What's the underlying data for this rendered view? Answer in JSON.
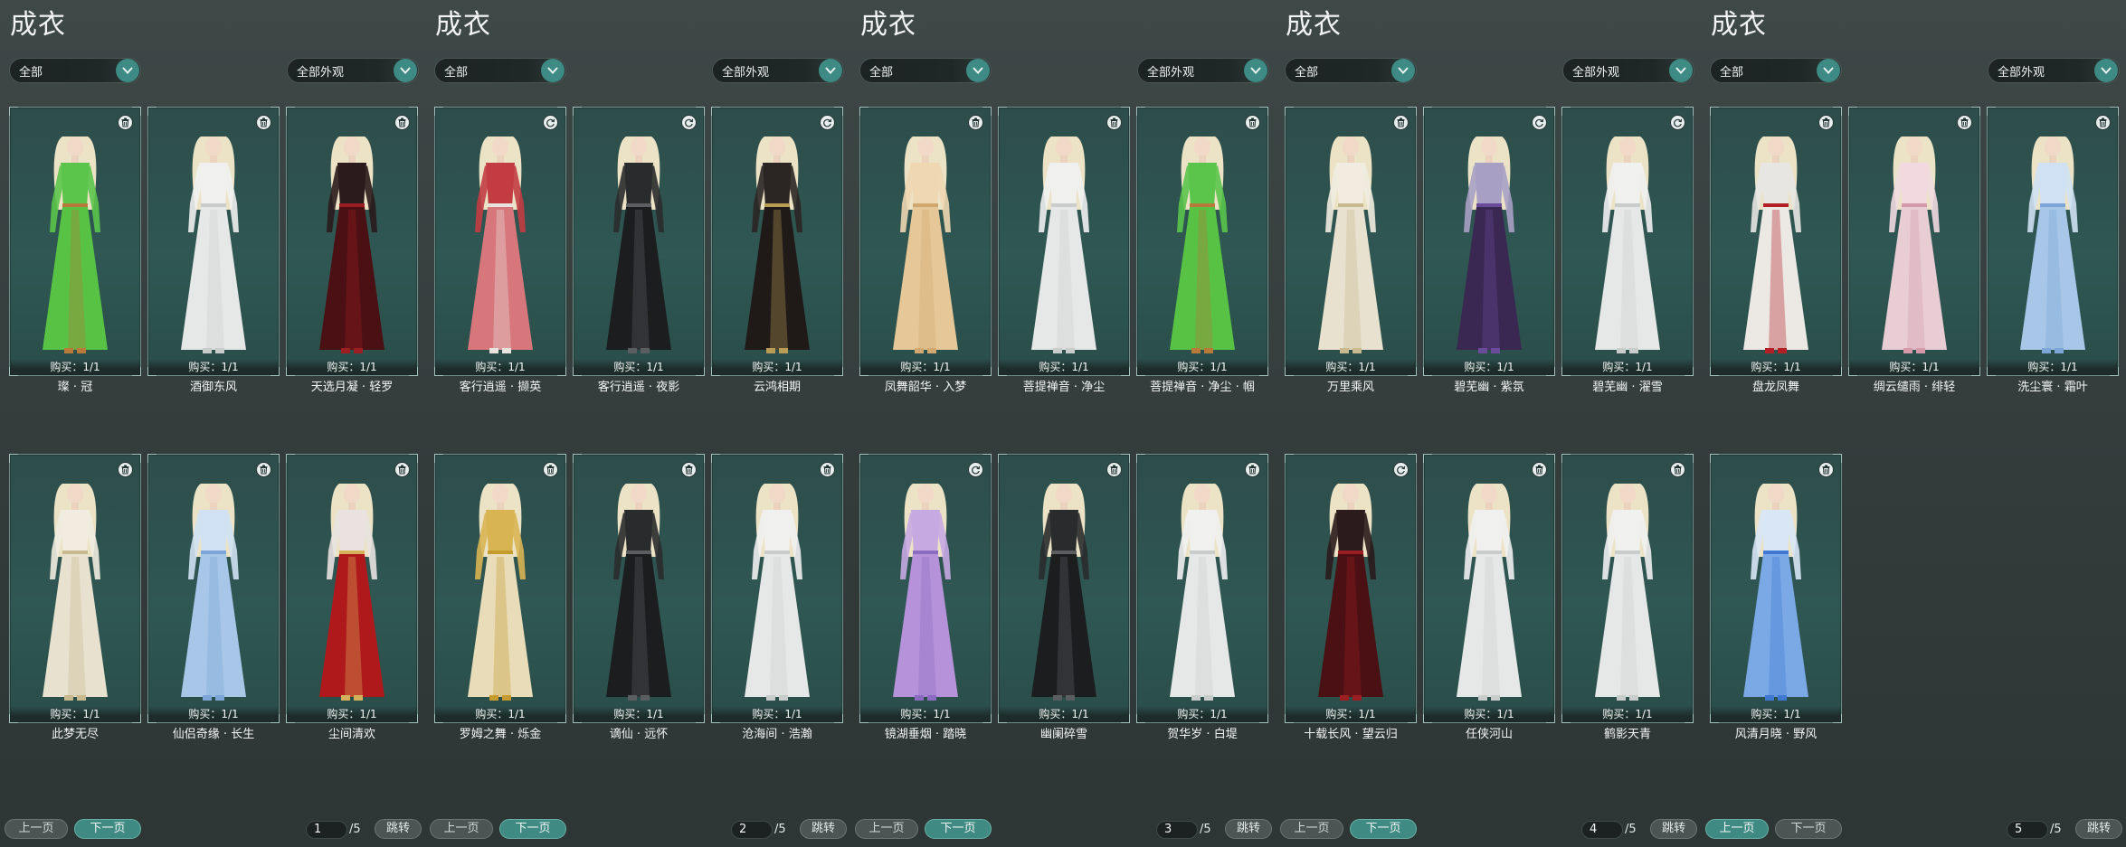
{
  "panels": [
    {
      "title": "成衣",
      "filter_category": "全部",
      "filter_appearance": "全部外观",
      "items": [
        {
          "name": "璨 · 冠",
          "buy": "购买：1/1",
          "icon": "trash-icon",
          "palette": "green"
        },
        {
          "name": "酒御东风",
          "buy": "购买：1/1",
          "icon": "trash-icon",
          "palette": "white"
        },
        {
          "name": "天选月凝 · 轻罗",
          "buy": "购买：1/1",
          "icon": "trash-icon",
          "palette": "blackred"
        },
        {
          "name": "此梦无尽",
          "buy": "购买：1/1",
          "icon": "trash-icon",
          "palette": "cream"
        },
        {
          "name": "仙侣奇缘 · 长生",
          "buy": "购买：1/1",
          "icon": "trash-icon",
          "palette": "lightblue"
        },
        {
          "name": "尘间清欢",
          "buy": "购买：1/1",
          "icon": "trash-icon",
          "palette": "red"
        }
      ],
      "pagination": {
        "prev": "上一页",
        "next": "下一页",
        "page": "1",
        "total": "/5",
        "jump": "跳转",
        "active": "next"
      }
    },
    {
      "title": "成衣",
      "filter_category": "全部",
      "filter_appearance": "全部外观",
      "items": [
        {
          "name": "客行逍遥 · 撷英",
          "buy": "购买：1/1",
          "icon": "refresh-icon",
          "palette": "pinkred"
        },
        {
          "name": "客行逍遥 · 夜影",
          "buy": "购买：1/1",
          "icon": "refresh-icon",
          "palette": "black"
        },
        {
          "name": "云鸿相期",
          "buy": "购买：1/1",
          "icon": "refresh-icon",
          "palette": "blackgold"
        },
        {
          "name": "罗姆之舞 · 烁金",
          "buy": "购买：1/1",
          "icon": "trash-icon",
          "palette": "gold"
        },
        {
          "name": "谪仙 · 远怀",
          "buy": "购买：1/1",
          "icon": "trash-icon",
          "palette": "black"
        },
        {
          "name": "沧海间 · 浩瀚",
          "buy": "购买：1/1",
          "icon": "trash-icon",
          "palette": "white"
        }
      ],
      "pagination": {
        "prev": "上一页",
        "next": "下一页",
        "page": "2",
        "total": "/5",
        "jump": "跳转",
        "active": "next"
      }
    },
    {
      "title": "成衣",
      "filter_category": "全部",
      "filter_appearance": "全部外观",
      "items": [
        {
          "name": "凤舞韶华 · 入梦",
          "buy": "购买：1/1",
          "icon": "trash-icon",
          "palette": "peach"
        },
        {
          "name": "菩提禅音 · 净尘",
          "buy": "购买：1/1",
          "icon": "trash-icon",
          "palette": "white"
        },
        {
          "name": "菩提禅音 · 净尘 · 帼",
          "buy": "购买：1/1",
          "icon": "trash-icon",
          "palette": "green"
        },
        {
          "name": "镜湖垂烟 · 踏晓",
          "buy": "购买：1/1",
          "icon": "refresh-icon",
          "palette": "lavender"
        },
        {
          "name": "幽阑碎雪",
          "buy": "购买：1/1",
          "icon": "trash-icon",
          "palette": "black"
        },
        {
          "name": "贺华岁 · 白堤",
          "buy": "购买：1/1",
          "icon": "trash-icon",
          "palette": "white"
        }
      ],
      "pagination": {
        "prev": "上一页",
        "next": "下一页",
        "page": "3",
        "total": "/5",
        "jump": "跳转",
        "active": "next"
      }
    },
    {
      "title": "成衣",
      "filter_category": "全部",
      "filter_appearance": "全部外观",
      "items": [
        {
          "name": "万里乘风",
          "buy": "购买：1/1",
          "icon": "trash-icon",
          "palette": "cream"
        },
        {
          "name": "碧芜幽 · 紫氛",
          "buy": "购买：1/1",
          "icon": "refresh-icon",
          "palette": "purple"
        },
        {
          "name": "碧芜幽 · 濯雪",
          "buy": "购买：1/1",
          "icon": "refresh-icon",
          "palette": "white"
        },
        {
          "name": "十载长风 · 望云归",
          "buy": "购买：1/1",
          "icon": "refresh-icon",
          "palette": "blackred"
        },
        {
          "name": "任侠河山",
          "buy": "购买：1/1",
          "icon": "trash-icon",
          "palette": "white"
        },
        {
          "name": "鹤影天青",
          "buy": "购买：1/1",
          "icon": "trash-icon",
          "palette": "white"
        }
      ],
      "pagination": {
        "prev": "上一页",
        "next": "下一页",
        "page": "4",
        "total": "/5",
        "jump": "跳转",
        "active": "next"
      }
    },
    {
      "title": "成衣",
      "filter_category": "全部",
      "filter_appearance": "全部外观",
      "items": [
        {
          "name": "盘龙凤舞",
          "buy": "购买：1/1",
          "icon": "trash-icon",
          "palette": "whitered"
        },
        {
          "name": "绸云缱雨 · 绯轻",
          "buy": "购买：1/1",
          "icon": "trash-icon",
          "palette": "pink"
        },
        {
          "name": "洗尘寰 · 霜叶",
          "buy": "购买：1/1",
          "icon": "trash-icon",
          "palette": "lightblue"
        },
        {
          "name": "风清月晓 · 野风",
          "buy": "购买：1/1",
          "icon": "trash-icon",
          "palette": "blue"
        }
      ],
      "pagination": {
        "prev": "上一页",
        "next": "下一页",
        "page": "5",
        "total": "/5",
        "jump": "跳转",
        "active": "prev"
      }
    }
  ],
  "colors": {
    "accent": "#3e8a84",
    "card_bg": "#2f5753",
    "background": "#3a4443"
  },
  "palettes": {
    "green": {
      "top": "#5bc44a",
      "dress": "#57c244",
      "accent": "#b77a3b"
    },
    "white": {
      "top": "#f0f0ef",
      "dress": "#e6e8e7",
      "accent": "#c8cdcc"
    },
    "blackred": {
      "top": "#2b1b1c",
      "dress": "#4a1013",
      "accent": "#9a1e22"
    },
    "cream": {
      "top": "#f1ecdf",
      "dress": "#e8e1cf",
      "accent": "#c8b98e"
    },
    "lightblue": {
      "top": "#cfe1f3",
      "dress": "#a8c7e8",
      "accent": "#7ba6d6"
    },
    "red": {
      "top": "#e9e2e0",
      "dress": "#b0191c",
      "accent": "#d6b15c"
    },
    "pinkred": {
      "top": "#c23c42",
      "dress": "#d7777c",
      "accent": "#e9e3e0"
    },
    "black": {
      "top": "#2a2b2c",
      "dress": "#1c1d1f",
      "accent": "#5a5e60"
    },
    "blackgold": {
      "top": "#2b2624",
      "dress": "#1f1a18",
      "accent": "#b89b55"
    },
    "gold": {
      "top": "#d9b453",
      "dress": "#e9dcb8",
      "accent": "#c59b2e"
    },
    "peach": {
      "top": "#eed7b1",
      "dress": "#e6c898",
      "accent": "#d0a870"
    },
    "lavender": {
      "top": "#c7a9e2",
      "dress": "#b592da",
      "accent": "#8c6cc1"
    },
    "purple": {
      "top": "#a7a0c4",
      "dress": "#3a2752",
      "accent": "#6a4b9a"
    },
    "whitered": {
      "top": "#e7e6e2",
      "dress": "#ece9e4",
      "accent": "#b21f24"
    },
    "pink": {
      "top": "#f1d9df",
      "dress": "#e9cdd5",
      "accent": "#d49aab"
    },
    "blue": {
      "top": "#d8e6f6",
      "dress": "#7aa9e6",
      "accent": "#3f78d0"
    }
  }
}
